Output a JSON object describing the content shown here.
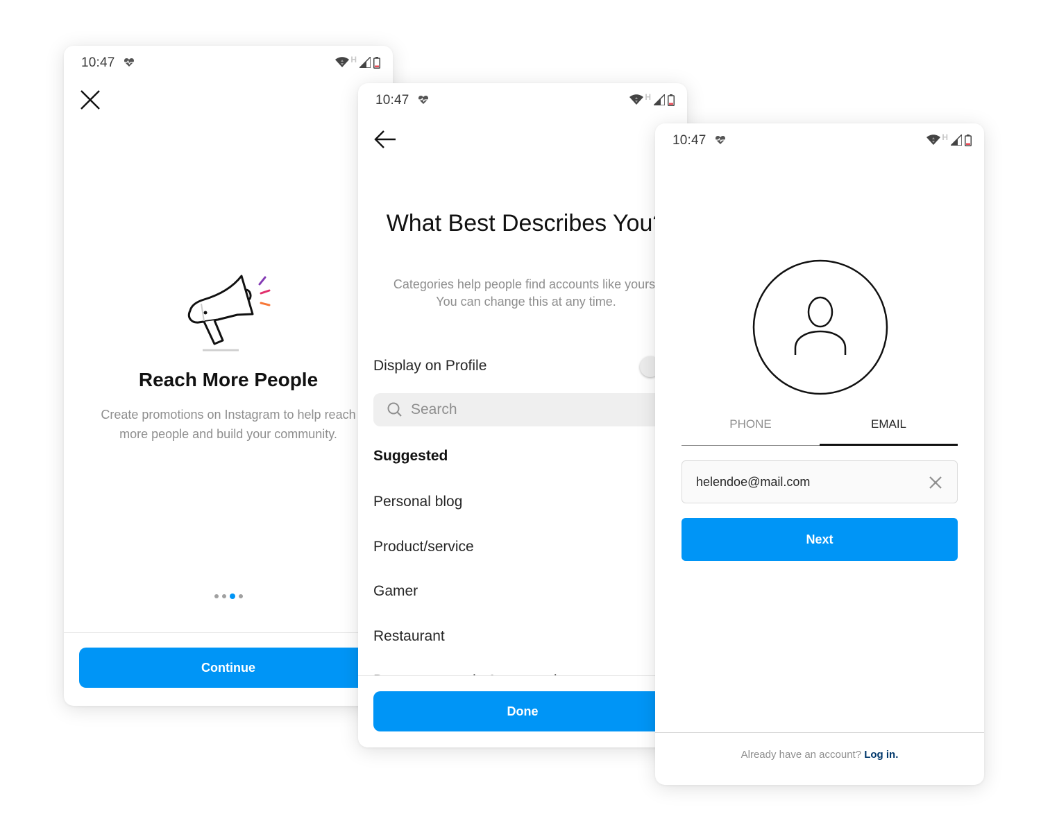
{
  "status_bar": {
    "time": "10:47",
    "network_label": "H",
    "battery_color": "#ed4956",
    "icons": [
      "heart-rate-icon",
      "wifi-icon",
      "signal-icon",
      "battery-icon"
    ]
  },
  "brand_blue": "#0095f6",
  "screen1": {
    "close_icon": "close-icon",
    "illustration": "megaphone-icon",
    "title": "Reach More People",
    "body": "Create promotions on Instagram to help reach more people and build your community.",
    "page_indicator": {
      "count": 4,
      "active_index": 2
    },
    "continue_label": "Continue"
  },
  "screen2": {
    "back_icon": "back-arrow-icon",
    "title": "What Best Describes You?",
    "subtitle_line1": "Categories help people find accounts like yours.",
    "subtitle_line2": "You can change this at any time.",
    "display_on_profile_label": "Display on Profile",
    "display_on_profile_on": false,
    "search_placeholder": "Search",
    "section_label": "Suggested",
    "categories": [
      "Personal blog",
      "Product/service",
      "Gamer",
      "Restaurant",
      "Beauty, cosmetic & personal care"
    ],
    "done_label": "Done"
  },
  "screen3": {
    "avatar_icon": "profile-placeholder-icon",
    "tabs": [
      {
        "label": "PHONE",
        "active": false
      },
      {
        "label": "EMAIL",
        "active": true
      }
    ],
    "email_value": "helendoe@mail.com",
    "next_label": "Next",
    "login_prompt": "Already have an account?",
    "login_link": "Log in."
  }
}
